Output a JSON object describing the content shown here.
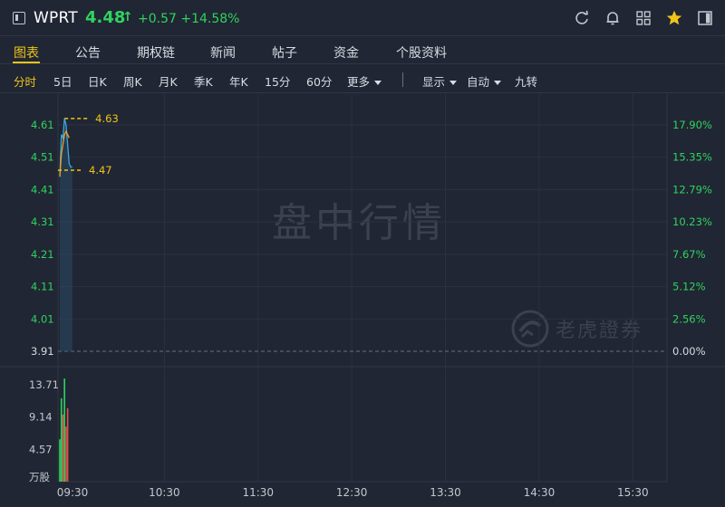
{
  "header": {
    "ticker": "WPRT",
    "price": "4.48",
    "change": "+0.57",
    "change_pct": "+14.58%",
    "up_color": "#2fd35f",
    "icons": [
      "refresh-icon",
      "bell-icon",
      "grid-icon",
      "star-icon",
      "panel-toggle-icon"
    ]
  },
  "tabs": [
    "图表",
    "公告",
    "期权链",
    "新闻",
    "帖子",
    "资金",
    "个股资料"
  ],
  "periods": {
    "items": [
      "分时",
      "5日",
      "日K",
      "周K",
      "月K",
      "季K",
      "年K",
      "15分",
      "60分"
    ],
    "more": "更多",
    "display": "显示",
    "auto": "自动",
    "nine": "九转"
  },
  "watermark": {
    "text": "盘中行情",
    "brand": "老虎證券"
  },
  "chart_data": {
    "type": "line",
    "x_ticks": [
      "09:30",
      "10:30",
      "11:30",
      "12:30",
      "13:30",
      "14:30",
      "15:30"
    ],
    "y_left_ticks": [
      "4.61",
      "4.51",
      "4.41",
      "4.31",
      "4.21",
      "4.11",
      "4.01",
      "3.91"
    ],
    "y_right_ticks": [
      "17.90%",
      "15.35%",
      "12.79%",
      "10.23%",
      "7.67%",
      "5.12%",
      "2.56%",
      "0.00%"
    ],
    "ylim": [
      3.91,
      4.66
    ],
    "prev_close": 3.91,
    "annotations": [
      {
        "label": "4.63",
        "value": 4.63
      },
      {
        "label": "4.47",
        "value": 4.47
      }
    ],
    "series": [
      {
        "type": "price",
        "color": "#36a8e0",
        "x_minutes": [
          0,
          1,
          2,
          3,
          4,
          5,
          6,
          7,
          8
        ],
        "values": [
          4.45,
          4.58,
          4.57,
          4.63,
          4.61,
          4.55,
          4.49,
          4.48,
          4.48
        ]
      },
      {
        "type": "avg",
        "color": "#f0a020",
        "x_minutes": [
          0,
          1,
          2,
          3,
          4,
          5,
          6
        ],
        "values": [
          4.45,
          4.52,
          4.55,
          4.58,
          4.59,
          4.58,
          4.57
        ]
      }
    ],
    "volume": {
      "unit": "万股",
      "y_ticks": [
        "13.71",
        "9.14",
        "4.57"
      ],
      "ylim": [
        0,
        15
      ],
      "bars": [
        {
          "minute": 0,
          "value": 6.0,
          "dir": "up"
        },
        {
          "minute": 1,
          "value": 11.8,
          "dir": "up"
        },
        {
          "minute": 2,
          "value": 9.5,
          "dir": "down"
        },
        {
          "minute": 3,
          "value": 14.6,
          "dir": "up"
        },
        {
          "minute": 4,
          "value": 7.8,
          "dir": "down"
        },
        {
          "minute": 5,
          "value": 10.4,
          "dir": "down"
        }
      ]
    }
  }
}
